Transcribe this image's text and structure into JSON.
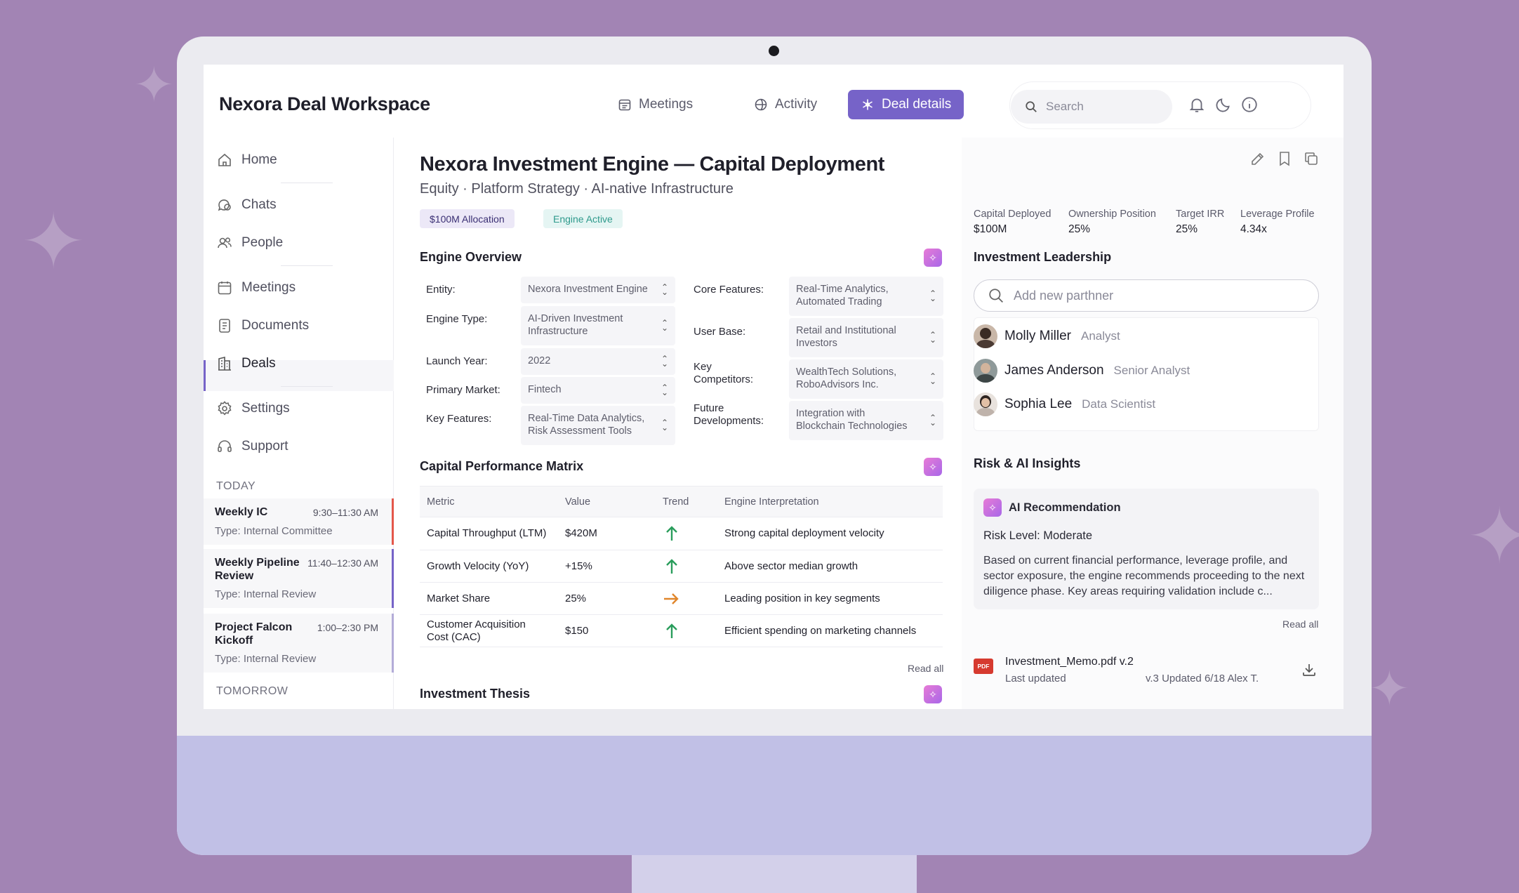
{
  "app": {
    "title": "Nexora Deal Workspace"
  },
  "nav": [
    {
      "label": "Meetings",
      "icon": "calendar-icon"
    },
    {
      "label": "Activity",
      "icon": "globe-icon"
    },
    {
      "label": "Deal details",
      "icon": "asterisk-icon"
    }
  ],
  "header": {
    "search_placeholder": "Search"
  },
  "sidebar": {
    "items": [
      {
        "label": "Home",
        "icon": "home-icon"
      },
      {
        "label": "Chats",
        "icon": "chat-icon"
      },
      {
        "label": "People",
        "icon": "people-icon"
      },
      {
        "label": "Meetings",
        "icon": "calendar-icon"
      },
      {
        "label": "Documents",
        "icon": "document-icon"
      },
      {
        "label": "Deals",
        "icon": "building-icon"
      },
      {
        "label": "Settings",
        "icon": "gear-icon"
      },
      {
        "label": "Support",
        "icon": "headset-icon"
      }
    ],
    "today_label": "TODAY",
    "tomorrow_label": "TOMORROW",
    "meetings": [
      {
        "title": "Weekly IC",
        "time": "9:30–11:30 AM",
        "type": "Type: Internal Committee",
        "color": "#e4574a"
      },
      {
        "title": "Weekly Pipeline Review",
        "time": "11:40–12:30 AM",
        "type": "Type: Internal Review",
        "color": "#7663c8"
      },
      {
        "title": "Project Falcon Kickoff",
        "time": "1:00–2:30 PM",
        "type": "Type: Internal Review",
        "color": "#b3acd8"
      }
    ]
  },
  "deal": {
    "title": "Nexora Investment Engine — Capital Deployment",
    "subtitle": "Equity · Platform Strategy · AI-native Infrastructure",
    "tags": [
      {
        "label": "$100M Allocation",
        "bg": "#ece8f7",
        "color": "#3a2f73"
      },
      {
        "label": "Engine Active",
        "bg": "#e5f5f3",
        "color": "#2e9a8c"
      }
    ]
  },
  "engine_overview": {
    "title": "Engine Overview",
    "left": [
      {
        "label": "Entity:",
        "value": "Nexora Investment Engine"
      },
      {
        "label": "Engine Type:",
        "value": "AI-Driven Investment Infrastructure"
      },
      {
        "label": "Launch Year:",
        "value": "2022"
      },
      {
        "label": "Primary Market:",
        "value": "Fintech"
      },
      {
        "label": "Key Features:",
        "value": "Real-Time Data Analytics, Risk Assessment Tools"
      }
    ],
    "right": [
      {
        "label": "Core Features:",
        "value": "Real-Time Analytics, Automated Trading"
      },
      {
        "label": "User Base:",
        "value": "Retail and Institutional Investors"
      },
      {
        "label": "Key Competitors:",
        "value": "WealthTech Solutions, RoboAdvisors Inc."
      },
      {
        "label": "Future Developments:",
        "value": "Integration with Blockchain Technologies"
      }
    ]
  },
  "matrix": {
    "title": "Capital Performance Matrix",
    "headers": [
      "Metric",
      "Value",
      "Trend",
      "Engine Interpretation"
    ],
    "rows": [
      {
        "metric": "Capital Throughput (LTM)",
        "value": "$420M",
        "trend": "up",
        "interpretation": "Strong capital deployment velocity"
      },
      {
        "metric": "Growth Velocity (YoY)",
        "value": "+15%",
        "trend": "up",
        "interpretation": "Above sector median growth"
      },
      {
        "metric": "Market Share",
        "value": "25%",
        "trend": "flat",
        "interpretation": "Leading position in key segments"
      },
      {
        "metric": "Customer Acquisition Cost (CAC)",
        "value": "$150",
        "trend": "up",
        "interpretation": "Efficient spending on marketing channels"
      }
    ],
    "read_all": "Read all"
  },
  "thesis": {
    "title": "Investment Thesis"
  },
  "stats": [
    {
      "label": "Capital Deployed",
      "value": "$100M"
    },
    {
      "label": "Ownership Position",
      "value": "25%"
    },
    {
      "label": "Target IRR",
      "value": "25%"
    },
    {
      "label": "Leverage Profile",
      "value": "4.34x"
    }
  ],
  "leadership": {
    "title": "Investment Leadership",
    "add_placeholder": "Add new parthner",
    "people": [
      {
        "name": "Molly Miller",
        "role": "Analyst"
      },
      {
        "name": "James Anderson",
        "role": "Senior Analyst"
      },
      {
        "name": "Sophia Lee",
        "role": "Data Scientist"
      }
    ]
  },
  "insights": {
    "title": "Risk & AI Insights",
    "card_title": "AI Recommendation",
    "risk_label": "Risk Level:",
    "risk_value": "Moderate",
    "text": "Based on current financial performance, leverage profile, and sector exposure, the engine recommends proceeding to the next diligence phase. Key areas requiring validation include c...",
    "read_all": "Read all"
  },
  "document": {
    "badge": "PDF",
    "name": "Investment_Memo.pdf v.2",
    "updated_label": "Last updated",
    "version": "v.3 Updated 6/18 Alex T."
  },
  "colors": {
    "accent": "#7663c8",
    "up": "#2a9d5c",
    "flat": "#e0862b"
  }
}
